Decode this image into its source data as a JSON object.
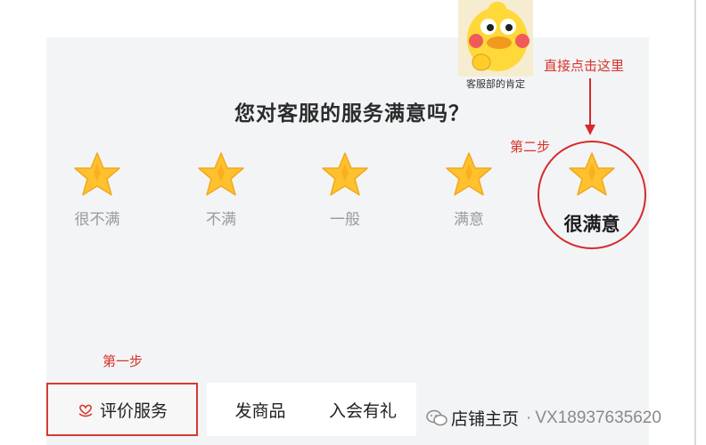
{
  "survey": {
    "question": "您对客服的服务满意吗？",
    "options": [
      {
        "label": "很不满"
      },
      {
        "label": "不满"
      },
      {
        "label": "一般"
      },
      {
        "label": "满意"
      },
      {
        "label": "很满意"
      }
    ],
    "selected_index": 4
  },
  "annotations": {
    "click_here": "直接点击这里",
    "step_two": "第二步",
    "step_one": "第一步",
    "sticker_caption": "客服部的肯定",
    "accent_color": "#d62a2a"
  },
  "tabs": [
    {
      "label": "评价服务",
      "icon": "heart-hand-icon"
    },
    {
      "label": "发商品"
    },
    {
      "label": "入会有礼"
    },
    {
      "label": "店铺主页"
    }
  ],
  "watermark": {
    "separator": "·",
    "text": "VX18937635620",
    "icon": "wechat-icon"
  },
  "colors": {
    "star_fill": "#ffc12e",
    "star_center": "#f59a12",
    "panel_bg": "#f3f4f6"
  }
}
